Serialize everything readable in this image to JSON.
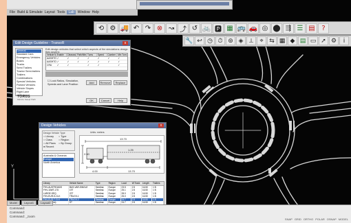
{
  "menubar": {
    "items": [
      "File",
      "Build & Simulate",
      "Layout",
      "Tools",
      "Lab",
      "Window",
      "Help"
    ],
    "active_index": 4
  },
  "toolbar_main": {
    "icons": [
      "vehicle-tool-icon",
      "path-tool-icon",
      "truck-icon",
      "arc-path-icon",
      "swept-path-icon",
      "delete-icon",
      "curve-tool-icon",
      "edit-path-icon",
      "turn-tool-icon",
      "bike-icon",
      "parking-icon",
      "grid-icon",
      "bus-icon",
      "car-icon",
      "roundabout-icon",
      "marker-icon",
      "railway-icon",
      "layers-icon",
      "report-icon",
      "help-icon"
    ],
    "glyphs": [
      "⟲",
      "⚙",
      "🚚",
      "↶",
      "↷",
      "⊗",
      "↝",
      "⤴",
      "↺",
      "🚲",
      "🅿",
      "▦",
      "🚌",
      "🚗",
      "◎",
      "⬤",
      "⇶",
      "☰",
      "▤",
      "?"
    ]
  },
  "toolbar_secondary": {
    "icons": [
      "wrench-icon",
      "reverse-icon",
      "dial-icon",
      "stopwatch-icon",
      "steering-icon",
      "compass-icon",
      "measure-icon",
      "survey-icon",
      "split-icon",
      "calc-icon",
      "tag-icon",
      "table-icon",
      "doc-icon",
      "pointer-icon",
      "settings-icon",
      "info-icon"
    ],
    "glyphs": [
      "🔧",
      "↩",
      "◷",
      "⏱",
      "⊚",
      "◈",
      "⟂",
      "⌖",
      "⇆",
      "▦",
      "◆",
      "▤",
      "▭",
      "➚",
      "⚙",
      "i"
    ]
  },
  "bg_window": {
    "title": ""
  },
  "dialog_guidelines": {
    "title": "Edit Design Guideline - TransoR",
    "close": "x",
    "tree_label": "Select Category",
    "tree_items": [
      "General",
      "Standard Cars",
      "Emergency Vehicles",
      "Buses",
      "Trucks",
      "Semi Trailers",
      "Tractor Semi-trailers",
      "Trailers",
      "Combinations",
      "Special Vehicles",
      "Parked Vehicles",
      "Vehicle Slopes",
      "Right Lane",
      "Left Lane"
    ],
    "tree_selected": 0,
    "description": "Edit design vehicles that select which aspects of the simulations design they govern:",
    "columns": [
      "Vehicle Name",
      "Enable",
      "Clearance",
      "Path/Mirror",
      "Turns",
      "Speed",
      "Camber",
      "Min Turn"
    ],
    "rows": [
      {
        "name": "AASHTO",
        "checks": [
          1,
          1,
          1,
          1,
          1,
          1,
          1
        ]
      },
      {
        "name": "AASHTO(A)",
        "checks": [
          1,
          1,
          1,
          1,
          1,
          1,
          1
        ]
      },
      {
        "name": "CRU",
        "checks": [
          1,
          1,
          0,
          1,
          1,
          0,
          1
        ]
      }
    ],
    "option_label": "Lock Ratios, Simulation, Speeds and Lane Position",
    "buttons": [
      "Add",
      "Remove",
      "Replace"
    ],
    "footer_buttons": [
      "OK",
      "Cancel",
      "Help"
    ],
    "logo": "TORUS",
    "logo_sub": "Vehicle Swept Path"
  },
  "dialog_vehicles": {
    "title": "Design Vehicles",
    "close": "x",
    "group_label": "Design Vehicle Type",
    "radio_options": [
      "Library",
      "Type",
      "Class",
      "Region",
      "All Plans",
      "By Group",
      "Recent",
      ""
    ],
    "radio_selected": 6,
    "list_label": "Australia & Oceania",
    "list_items": [
      "Europe",
      "North America"
    ],
    "list_selected": 0,
    "units": "Units: meters",
    "dims": [
      "4.00",
      "13.70",
      "2.60",
      "1.25"
    ],
    "table_columns": [
      "Library",
      "Vehicle Name",
      "Type",
      "Region",
      "Load",
      "W.Track",
      "Length",
      "Trailers"
    ],
    "table_rows": [
      [
        "FHV-AUSTROADS",
        "BUS-VAR-SINGLE",
        "Semitrai.",
        "Europe",
        "23.5",
        "2.5",
        "16.50",
        "1 B"
      ],
      [
        "FHV-10WT-175",
        "19T",
        "Semitrai.",
        "Europe",
        "25.1",
        "2.5",
        "16.50",
        "1 B"
      ],
      [
        "LARGE-SEQ",
        "22T",
        "Semitrai.",
        "Europe",
        "28.0",
        "2.5",
        "16.50",
        "1 B"
      ],
      [
        "FHV-EUR-S-CLK",
        "TRUCK-1",
        "Semitrai.",
        "Europe",
        "25.0",
        "2.5",
        "16.50",
        "1 B"
      ],
      [
        "FHV-EUR-T-CLK",
        "TRUCK-2",
        "Semitrai.",
        "Europe",
        "24.7",
        "2.5",
        "16.50",
        "1 B"
      ],
      [
        "TRUCK (6m)",
        "ST",
        "Semitrai.",
        "Europe",
        "24.7",
        "2.5",
        "16.50",
        "1 B"
      ]
    ],
    "table_selected": 4,
    "footer_buttons": [
      "OK",
      "Cancel",
      "Help"
    ]
  },
  "command_line": {
    "tabs": [
      "Model",
      "Layout1",
      "Layout2"
    ],
    "lines": [
      "Command:",
      "Command:",
      "Command: _zoom"
    ],
    "status": [
      "SNAP",
      "GRID",
      "ORTHO",
      "POLAR",
      "OSNAP",
      "MODEL"
    ]
  },
  "colors": {
    "road": "#d9d9d9",
    "background": "#050505",
    "title": "#5a73a3",
    "accent_select": "#3468b4"
  }
}
